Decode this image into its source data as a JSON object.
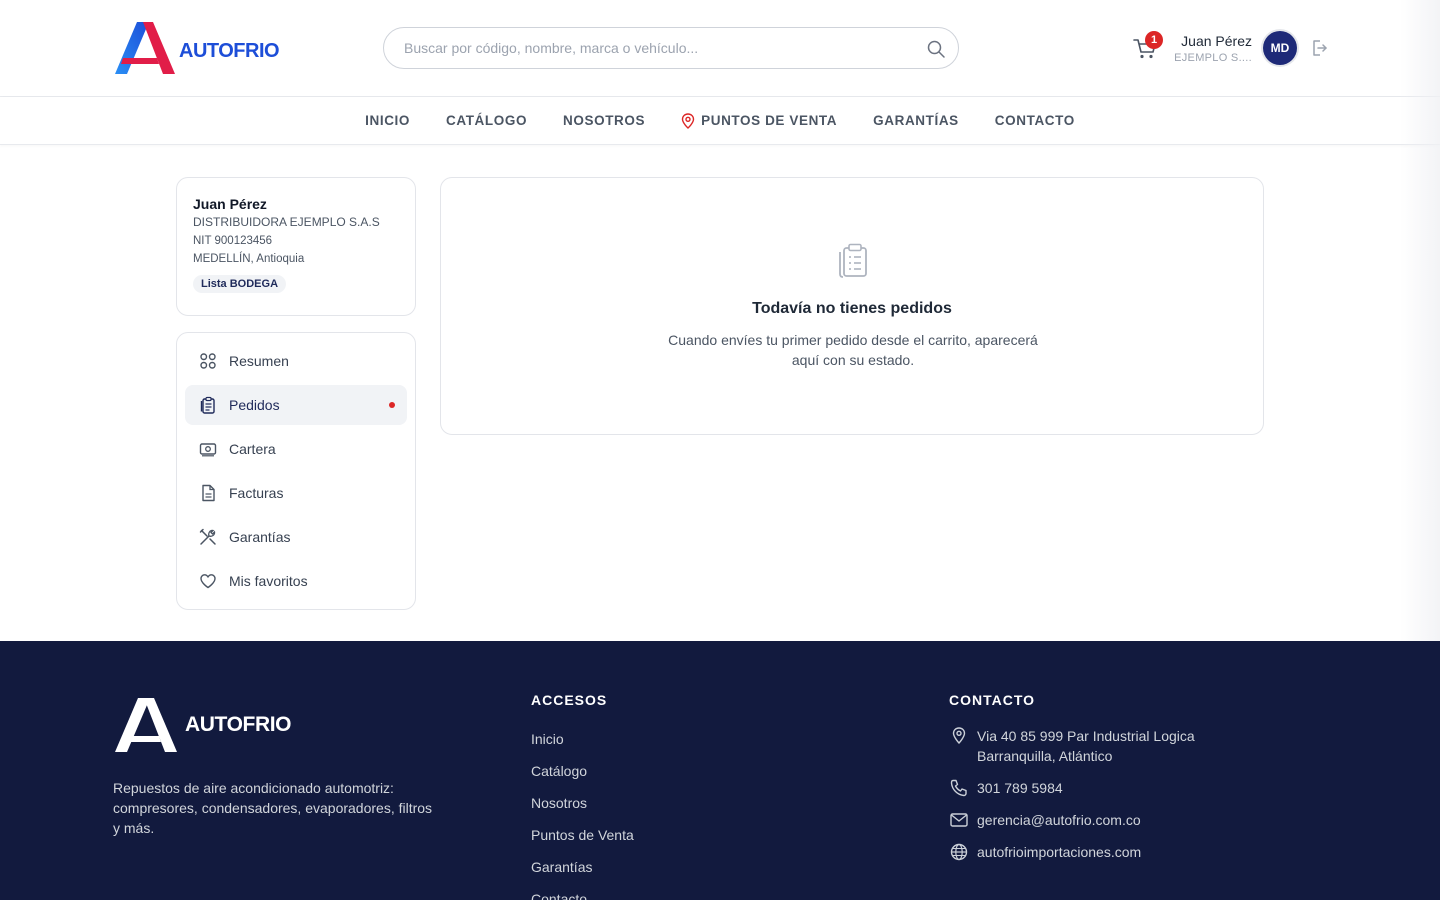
{
  "header": {
    "brand": "AUTOFRIO",
    "search_placeholder": "Buscar por código, nombre, marca o vehículo...",
    "cart_count": "1",
    "user_name": "Juan Pérez",
    "user_company": "EJEMPLO S....",
    "avatar_initials": "MD"
  },
  "nav": {
    "items": [
      "INICIO",
      "CATÁLOGO",
      "NOSOTROS",
      "PUNTOS DE VENTA",
      "GARANTÍAS",
      "CONTACTO"
    ]
  },
  "profile": {
    "name": "Juan Pérez",
    "company": "DISTRIBUIDORA EJEMPLO S.A.S",
    "nit": "NIT 900123456",
    "location": "MEDELLÍN, Antioquia",
    "list_badge": "Lista BODEGA"
  },
  "menu": {
    "items": [
      {
        "label": "Resumen",
        "icon": "grid-icon"
      },
      {
        "label": "Pedidos",
        "icon": "clipboard-list-icon"
      },
      {
        "label": "Cartera",
        "icon": "wallet-icon"
      },
      {
        "label": "Facturas",
        "icon": "document-icon"
      },
      {
        "label": "Garantías",
        "icon": "tools-icon"
      },
      {
        "label": "Mis favoritos",
        "icon": "heart-icon"
      }
    ],
    "active_index": 1
  },
  "empty_state": {
    "title": "Todavía no tienes pedidos",
    "text": "Cuando envíes tu primer pedido desde el carrito, aparecerá aquí con su estado."
  },
  "footer": {
    "brand": "AUTOFRIO",
    "description": "Repuestos de aire acondicionado automotriz: compresores, condensadores, evaporadores, filtros y más.",
    "access_title": "ACCESOS",
    "links": [
      "Inicio",
      "Catálogo",
      "Nosotros",
      "Puntos de Venta",
      "Garantías",
      "Contacto"
    ],
    "contact_title": "CONTACTO",
    "address": "Via 40 85 999 Par Industrial Logica Barranquilla, Atlántico",
    "phone": "301 789 5984",
    "email": "gerencia@autofrio.com.co",
    "website": "autofrioimportaciones.com"
  },
  "colors": {
    "brand_blue": "#1d4ed8",
    "brand_red": "#dc2626",
    "footer_bg": "#121a3e",
    "avatar_bg": "#1e2a78"
  }
}
